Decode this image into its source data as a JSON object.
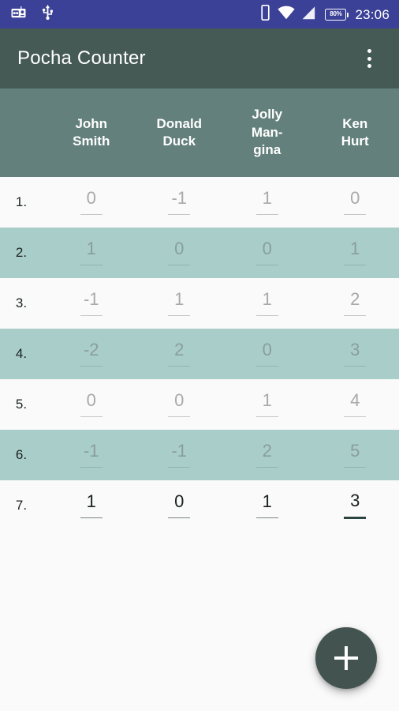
{
  "status_bar": {
    "background_color": "#3b4196",
    "left_icons": [
      "radio-icon",
      "usb-icon"
    ],
    "right_icons": [
      "vibrate-icon",
      "wifi-icon",
      "signal-icon"
    ],
    "battery_percent": "80%",
    "time": "23:06"
  },
  "app_bar": {
    "title": "Pocha Counter",
    "background_color": "#455a54",
    "overflow_menu": "more-options"
  },
  "table": {
    "header_background_color": "#63807c",
    "row_alt_color": "#a9cdc9",
    "row_base_color": "#fafafa",
    "columns": [
      {
        "name": "John\nSmith"
      },
      {
        "name": "Donald\nDuck"
      },
      {
        "name": "Jolly\nMan-\ngina"
      },
      {
        "name": "Ken\nHurt"
      }
    ],
    "rows": [
      {
        "label": "1.",
        "values": [
          "0",
          "-1",
          "1",
          "0"
        ],
        "highlighted": false,
        "active": false
      },
      {
        "label": "2.",
        "values": [
          "1",
          "0",
          "0",
          "1"
        ],
        "highlighted": true,
        "active": false
      },
      {
        "label": "3.",
        "values": [
          "-1",
          "1",
          "1",
          "2"
        ],
        "highlighted": false,
        "active": false
      },
      {
        "label": "4.",
        "values": [
          "-2",
          "2",
          "0",
          "3"
        ],
        "highlighted": true,
        "active": false
      },
      {
        "label": "5.",
        "values": [
          "0",
          "0",
          "1",
          "4"
        ],
        "highlighted": false,
        "active": false
      },
      {
        "label": "6.",
        "values": [
          "-1",
          "-1",
          "2",
          "5"
        ],
        "highlighted": true,
        "active": false
      },
      {
        "label": "7.",
        "values": [
          "1",
          "0",
          "1",
          "3"
        ],
        "highlighted": false,
        "active": true,
        "focused_column": 3
      }
    ]
  },
  "fab": {
    "label": "+",
    "name": "add-round-button",
    "color": "#435450"
  }
}
